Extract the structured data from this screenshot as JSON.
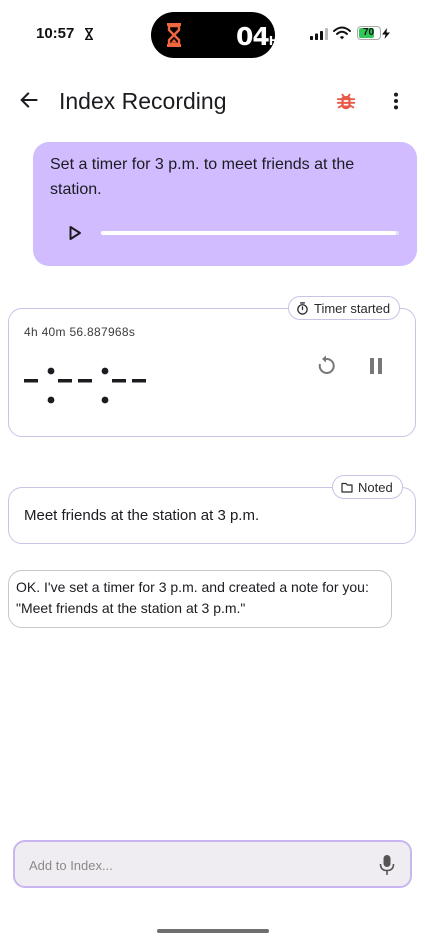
{
  "status_bar": {
    "time": "10:57",
    "countdown_value": "04",
    "countdown_unit": "H",
    "battery_level": "70",
    "colors": {
      "hourglass": "#f0663f",
      "battery": "#34c759"
    }
  },
  "app_bar": {
    "title": "Index Recording",
    "icons": [
      "back-arrow-icon",
      "bug-icon",
      "more-vert-icon"
    ],
    "bug_color": "#e8594a"
  },
  "user_message": {
    "text": "Set a timer for 3 p.m. to meet friends at the station.",
    "audio_progress": 0.99,
    "bubble_color": "#d0bcff"
  },
  "timer_card": {
    "badge_label": "Timer started",
    "elapsed": "4h 40m 56.887968s",
    "display": "--:--:--"
  },
  "note_card": {
    "badge_label": "Noted",
    "text": "Meet friends at the station at 3 p.m."
  },
  "assistant_reply": {
    "text": "OK. I've set a timer for 3 p.m. and created a note for you: \"Meet friends at the station at 3 p.m.\""
  },
  "composer": {
    "placeholder": "Add to Index...",
    "value": ""
  }
}
